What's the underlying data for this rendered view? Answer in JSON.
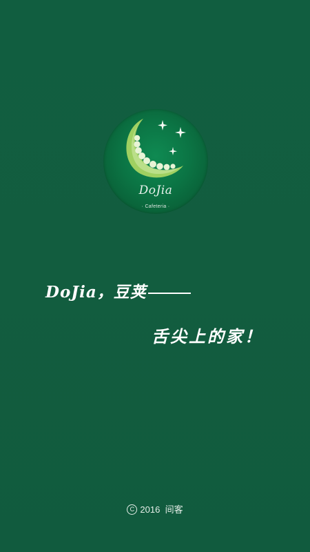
{
  "logo": {
    "brand": "DoJia",
    "subtitle": "· Cafeteria ·"
  },
  "slogan": {
    "line1": "DoJia，豆荚",
    "line2": "舌尖上的家！"
  },
  "footer": {
    "year": "2016",
    "company": "间客"
  }
}
